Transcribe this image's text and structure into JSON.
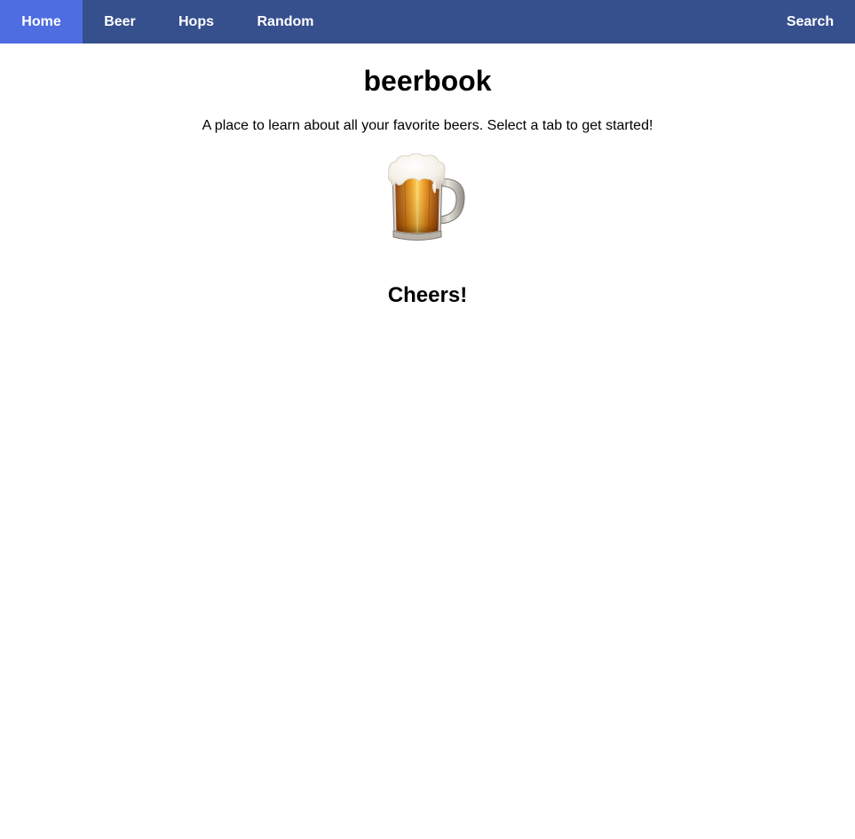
{
  "nav": {
    "items": [
      {
        "label": "Home",
        "active": true
      },
      {
        "label": "Beer",
        "active": false
      },
      {
        "label": "Hops",
        "active": false
      },
      {
        "label": "Random",
        "active": false
      }
    ],
    "search_label": "Search",
    "colors": {
      "bar": "#364f8d",
      "active": "#4e6de0",
      "text": "#ffffff"
    }
  },
  "main": {
    "title": "beerbook",
    "tagline": "A place to learn about all your favorite beers. Select a tab to get started!",
    "image_icon": "beer-mug-icon",
    "closing": "Cheers!"
  }
}
